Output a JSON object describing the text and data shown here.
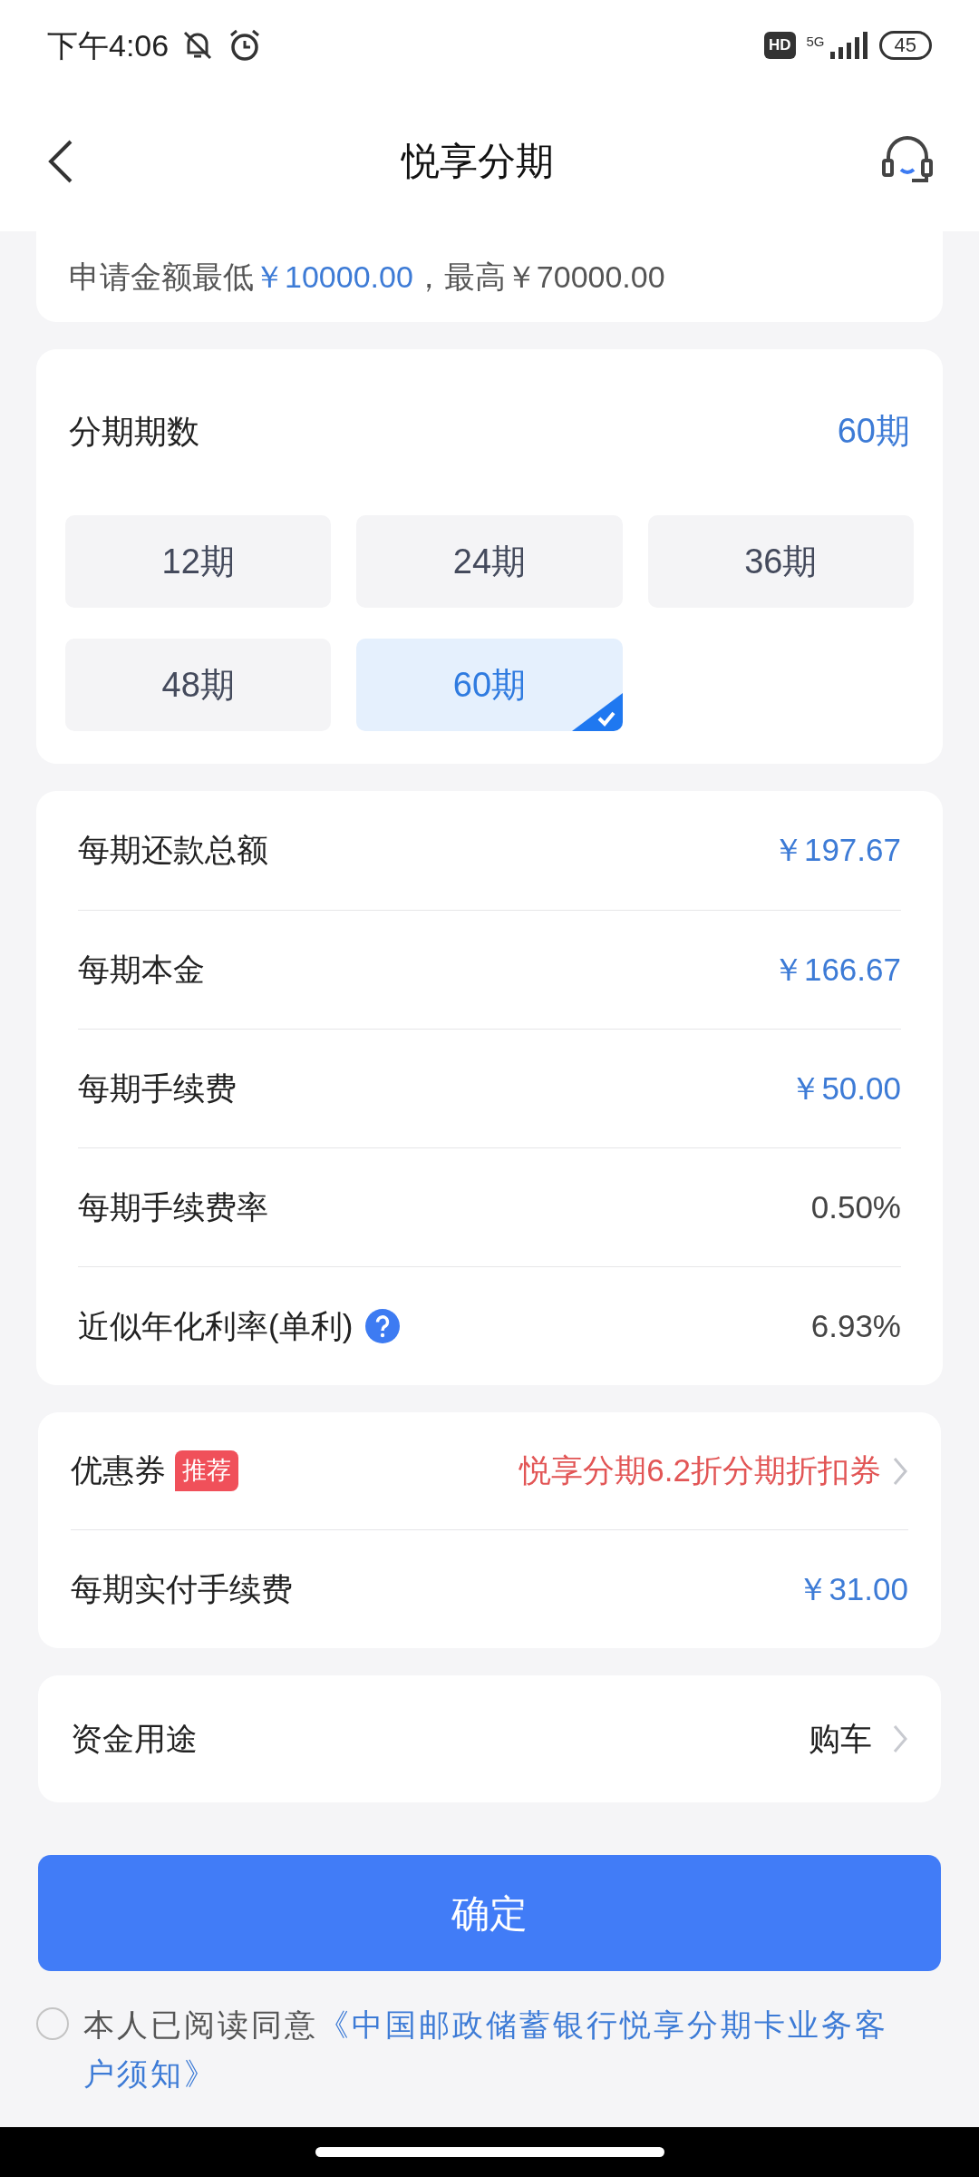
{
  "status_bar": {
    "time": "下午4:06",
    "hd": "HD",
    "network": "5G",
    "battery": "45"
  },
  "header": {
    "title": "悦享分期"
  },
  "amount_range": {
    "prefix": "申请金额最低",
    "min": "￥10000.00",
    "suffix": "，最高￥70000.00"
  },
  "periods": {
    "label": "分期期数",
    "current": "60期",
    "options": [
      {
        "label": "12期",
        "selected": false
      },
      {
        "label": "24期",
        "selected": false
      },
      {
        "label": "36期",
        "selected": false
      },
      {
        "label": "48期",
        "selected": false
      },
      {
        "label": "60期",
        "selected": true
      }
    ]
  },
  "details": [
    {
      "label": "每期还款总额",
      "value": "￥197.67",
      "highlight": true
    },
    {
      "label": "每期本金",
      "value": "￥166.67",
      "highlight": true
    },
    {
      "label": "每期手续费",
      "value": "￥50.00",
      "highlight": true
    },
    {
      "label": "每期手续费率",
      "value": "0.50%",
      "highlight": false
    },
    {
      "label": "近似年化利率(单利)",
      "value": "6.93%",
      "highlight": false,
      "help": true
    }
  ],
  "coupon": {
    "label": "优惠券",
    "badge": "推荐",
    "value": "悦享分期6.2折分期折扣券",
    "fee_label": "每期实付手续费",
    "fee_value": "￥31.00"
  },
  "purpose": {
    "label": "资金用途",
    "value": "购车"
  },
  "confirm_button": "确定",
  "agreement": {
    "checked": false,
    "text": "本人已阅读同意",
    "link_lines": [
      "《中国邮政储蓄银行悦享分期卡业务客",
      "户须知》"
    ]
  }
}
